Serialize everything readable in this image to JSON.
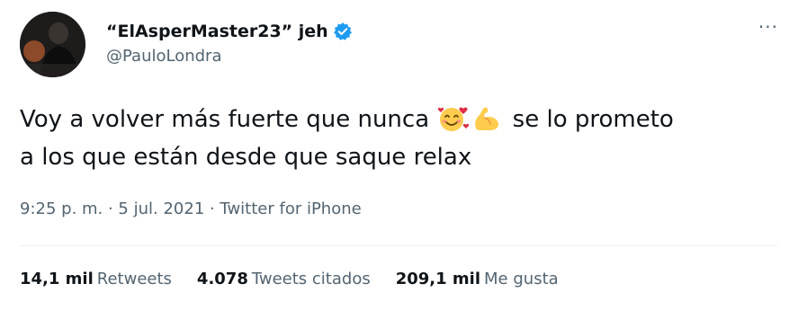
{
  "author": {
    "display_name": "“ElAsperMaster23” jeh",
    "handle": "@PauloLondra",
    "verified": true
  },
  "tweet": {
    "text_line1_a": "Voy a volver más fuerte que nunca",
    "text_line1_b": "se lo prometo",
    "text_line2": "a los que están desde que saque relax",
    "emojis": [
      "smiling-face-with-hearts",
      "flexed-biceps"
    ],
    "timestamp": "9:25 p. m. · 5 jul. 2021 · Twitter for iPhone"
  },
  "stats": {
    "retweets_count": "14,1 mil",
    "retweets_label": "Retweets",
    "quotes_count": "4.078",
    "quotes_label": "Tweets citados",
    "likes_count": "209,1 mil",
    "likes_label": "Me gusta"
  },
  "menu": {
    "more_label": "···"
  },
  "colors": {
    "primary_text": "#0f1419",
    "secondary_text": "#536471",
    "verified_blue": "#1d9bf0",
    "divider": "#eff3f4"
  }
}
